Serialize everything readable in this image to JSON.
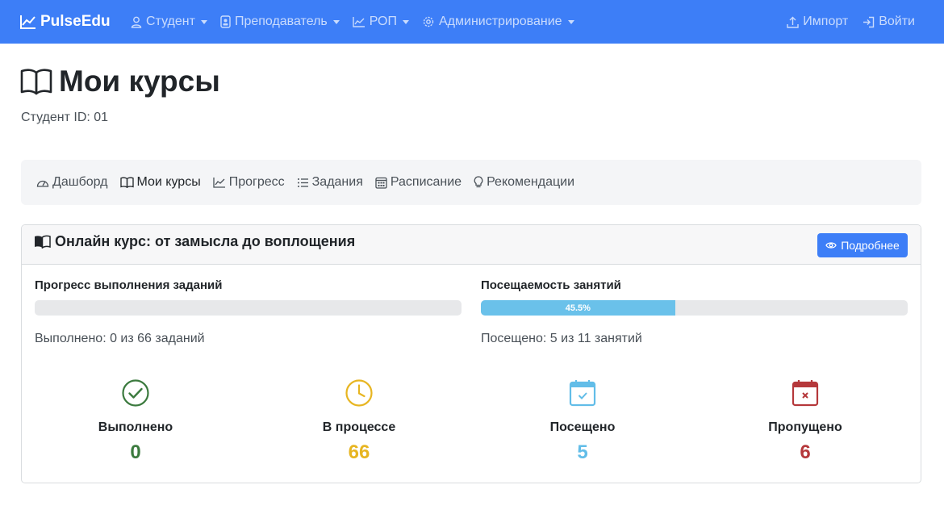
{
  "navbar": {
    "brand": "PulseEdu",
    "menus": [
      {
        "label": "Студент",
        "icon": "user-icon"
      },
      {
        "label": "Преподаватель",
        "icon": "id-badge-icon"
      },
      {
        "label": "РОП",
        "icon": "chart-line-icon"
      },
      {
        "label": "Администрирование",
        "icon": "gear-icon"
      }
    ],
    "import_label": "Импорт",
    "login_label": "Войти"
  },
  "page": {
    "title": "Мои курсы",
    "student_id": "Студент ID: 01"
  },
  "tabs": [
    {
      "label": "Дашборд",
      "icon": "speedometer-icon",
      "active": false
    },
    {
      "label": "Мои курсы",
      "icon": "book-icon",
      "active": true
    },
    {
      "label": "Прогресс",
      "icon": "chart-line-icon",
      "active": false
    },
    {
      "label": "Задания",
      "icon": "list-icon",
      "active": false
    },
    {
      "label": "Расписание",
      "icon": "calendar-icon",
      "active": false
    },
    {
      "label": "Рекомендации",
      "icon": "lightbulb-icon",
      "active": false
    }
  ],
  "course": {
    "title": "Онлайн курс: от замысла до воплощения",
    "details_button": "Подробнее",
    "assignments": {
      "label": "Прогресс выполнения заданий",
      "percent": 0,
      "text": "Выполнено: 0 из 66 заданий"
    },
    "attendance": {
      "label": "Посещаемость занятий",
      "percent": 45.5,
      "bar_text": "45.5%",
      "text": "Посещено: 5 из 11 занятий"
    },
    "stats": [
      {
        "label": "Выполнено",
        "value": "0",
        "icon": "check-circle-icon",
        "color": "#3b7a3e"
      },
      {
        "label": "В процессе",
        "value": "66",
        "icon": "clock-icon",
        "color": "#e7b521"
      },
      {
        "label": "Посещено",
        "value": "5",
        "icon": "calendar-check-icon",
        "color": "#62bde8"
      },
      {
        "label": "Пропущено",
        "value": "6",
        "icon": "calendar-x-icon",
        "color": "#b5383b"
      }
    ]
  },
  "colors": {
    "navbar": "#3d7ef7",
    "progress_fill": "#6ac1ea"
  }
}
